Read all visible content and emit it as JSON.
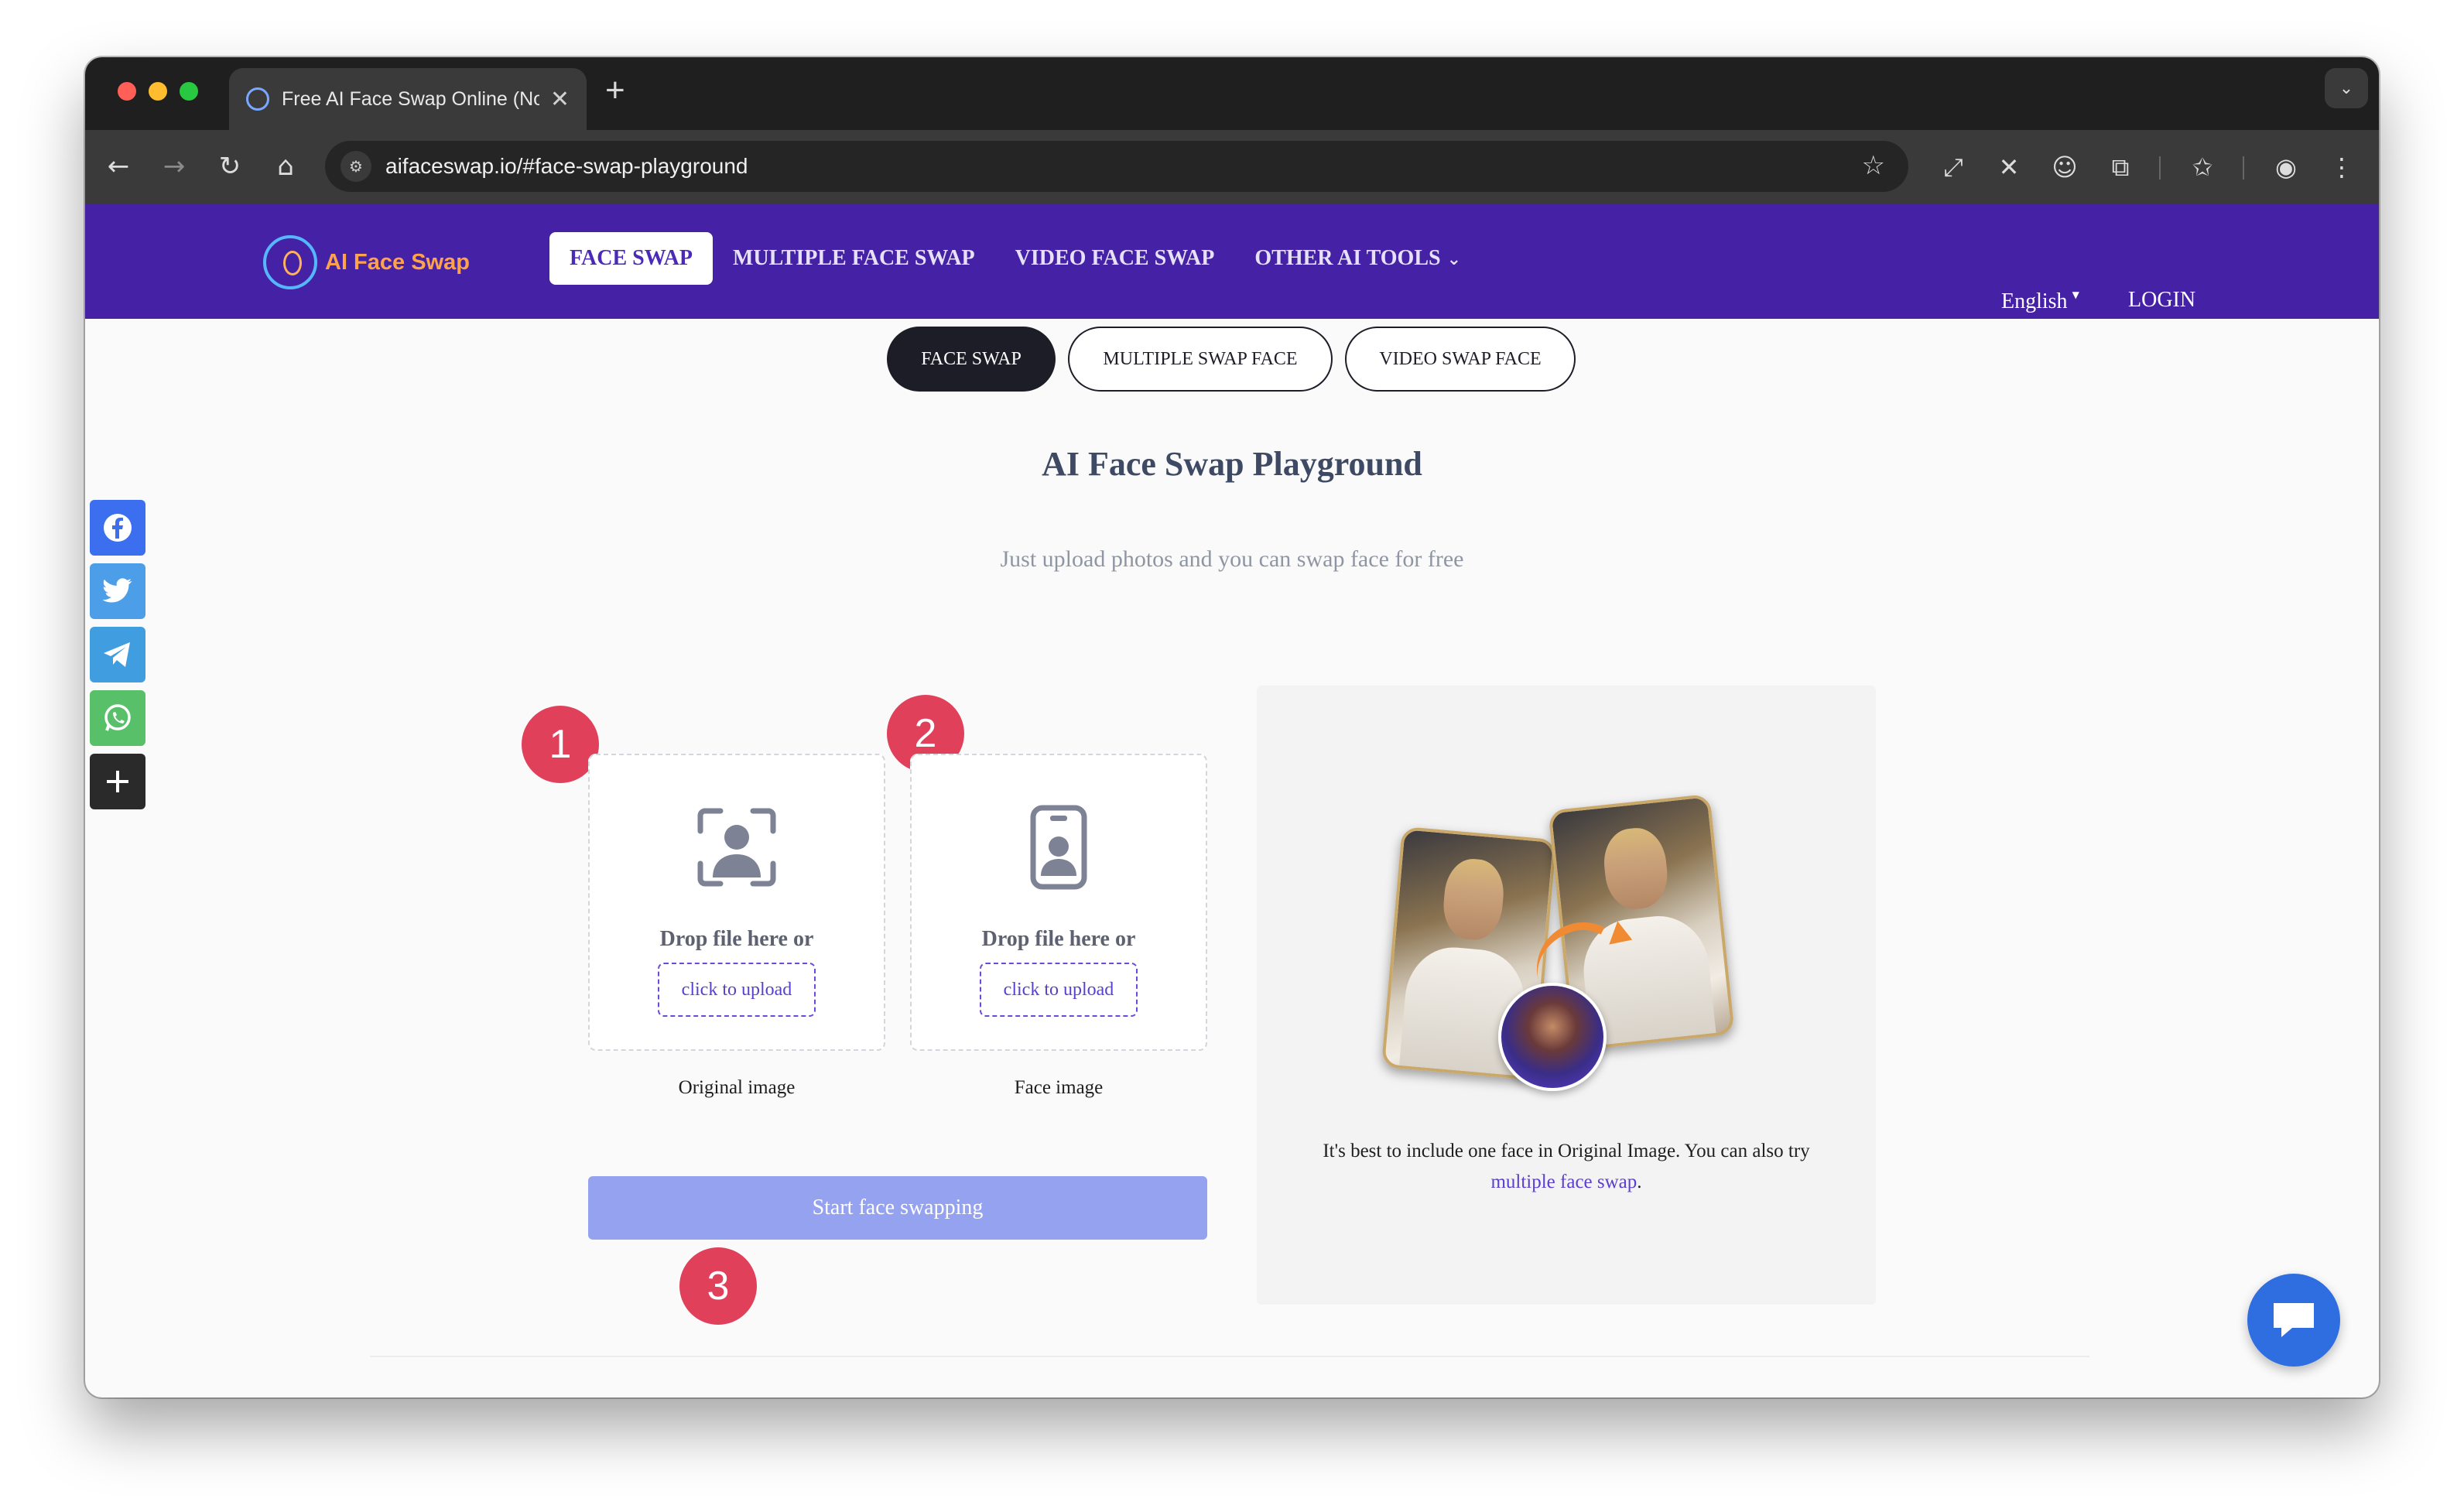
{
  "browser": {
    "tab_title": "Free AI Face Swap Online (No",
    "tab_close": "✕",
    "new_tab": "+",
    "url": "aifaceswap.io/#face-swap-playground"
  },
  "header": {
    "logo_text": "AI Face Swap",
    "nav": [
      {
        "label": "FACE SWAP",
        "active": true
      },
      {
        "label": "MULTIPLE FACE SWAP",
        "active": false
      },
      {
        "label": "VIDEO FACE SWAP",
        "active": false
      },
      {
        "label": "OTHER AI TOOLS",
        "active": false
      }
    ],
    "language": "English",
    "login": "LOGIN"
  },
  "subtabs": [
    {
      "label": "FACE SWAP",
      "active": true
    },
    {
      "label": "MULTIPLE SWAP FACE",
      "active": false
    },
    {
      "label": "VIDEO SWAP FACE",
      "active": false
    }
  ],
  "main": {
    "title": "AI Face Swap Playground",
    "subtitle": "Just upload photos and you can swap face for free",
    "steps": [
      "1",
      "2",
      "3"
    ],
    "uploads": [
      {
        "drop_text": "Drop file here or",
        "button": "click to upload",
        "caption": "Original image",
        "icon": "face-scan-icon"
      },
      {
        "drop_text": "Drop file here or",
        "button": "click to upload",
        "caption": "Face image",
        "icon": "id-badge-icon"
      }
    ],
    "start_button": "Start face swapping",
    "note_text": "It's best to include one face in Original Image. You can also try",
    "note_link": "multiple face swap",
    "note_end": "."
  },
  "social": [
    {
      "name": "facebook-icon",
      "color": "#3b6ff0"
    },
    {
      "name": "twitter-icon",
      "color": "#4d9ee8"
    },
    {
      "name": "telegram-icon",
      "color": "#3f9de0"
    },
    {
      "name": "whatsapp-icon",
      "color": "#59c06a"
    },
    {
      "name": "share-plus-icon",
      "color": "#2a2a2a"
    }
  ],
  "colors": {
    "brand": "#4521a6",
    "accent": "#5a3fcf",
    "step_badge": "#e1405a",
    "start_button": "#95a2ef",
    "chat_button": "#2f6ee0"
  }
}
